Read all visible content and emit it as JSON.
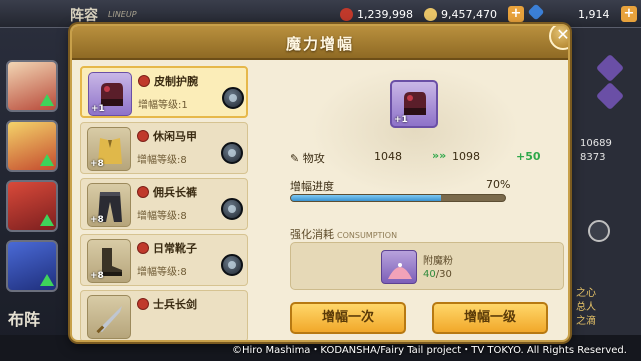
{
  "background": {
    "title": "阵容",
    "title_sub": "LINEUP",
    "power": "1,239,998",
    "gold": "9,457,470",
    "gems": "1,914",
    "right_stats": [
      "10689",
      "8373"
    ],
    "right_labels": [
      "之心",
      "总人",
      "之滴"
    ],
    "left_bottom": "布阵"
  },
  "modal": {
    "title": "魔力增幅",
    "close": "✕"
  },
  "items": [
    {
      "name": "皮制护腕",
      "level_label": "增幅等级",
      "level": "1",
      "plus": "+1",
      "selected": true,
      "icon": "gloves-icon"
    },
    {
      "name": "休闲马甲",
      "level_label": "增幅等级",
      "level": "8",
      "plus": "+8",
      "selected": false,
      "icon": "vest-icon"
    },
    {
      "name": "佣兵长裤",
      "level_label": "增幅等级",
      "level": "8",
      "plus": "+8",
      "selected": false,
      "icon": "pants-icon"
    },
    {
      "name": "日常靴子",
      "level_label": "增幅等级",
      "level": "8",
      "plus": "+8",
      "selected": false,
      "icon": "boots-icon"
    },
    {
      "name": "士兵长剑",
      "level_label": "",
      "level": "",
      "plus": "",
      "selected": false,
      "icon": "sword-icon"
    }
  ],
  "details": {
    "plus": "+1",
    "stat_label": "物攻",
    "stat_from": "1048",
    "stat_to": "1098",
    "stat_gain": "+50",
    "progress_label": "增幅进度",
    "progress_pct_text": "70%",
    "progress_value": 70,
    "consume_title": "强化消耗",
    "consume_sub": "CONSUMPTION",
    "material_name": "附魔粉",
    "material_have": "40",
    "material_need": "/30",
    "btn_once": "增幅一次",
    "btn_level": "增幅一级"
  },
  "copyright": "©Hiro Mashima・KODANSHA/Fairy Tail project・TV TOKYO. All Rights Reserved.",
  "colors": {
    "modal_bg": "#f4ecd7",
    "header": "#b9903e",
    "accent_green": "#2fa84a",
    "progress_blue": "#3a93d0",
    "button_gold": "#f1a82a"
  }
}
